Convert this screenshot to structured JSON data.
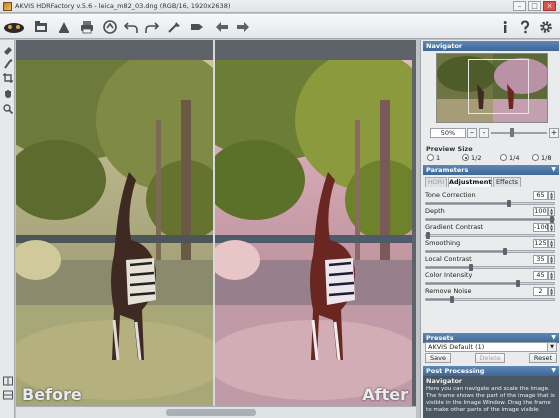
{
  "window": {
    "title": "AKVIS HDRFactory v.5.6 - leica_m82_03.dng (RGB/16, 1920x2638)",
    "controls": [
      "–",
      "□",
      "×"
    ]
  },
  "toolbar": {
    "icons": [
      "app-logo",
      "open-icon",
      "save-icon",
      "print-icon",
      "share-icon",
      "undo-icon",
      "redo-icon",
      "run-icon",
      "batch-icon",
      "back-icon",
      "forward-icon",
      "info-icon",
      "help-icon",
      "settings-icon"
    ]
  },
  "image": {
    "before_label": "Before",
    "after_label": "After"
  },
  "navigator": {
    "header": "Navigator",
    "zoom_value": "50%",
    "zoom_minus": "–",
    "zoom_plus": "+",
    "zoom_level_fraction": 0.38
  },
  "preview_size": {
    "header": "Preview Size",
    "options": [
      "1",
      "1/2",
      "1/4",
      "1/8"
    ],
    "selected": "1/2"
  },
  "parameters": {
    "header": "Parameters",
    "tabs": [
      "HDRI",
      "Adjustment",
      "Effects"
    ],
    "active_tab": "Adjustment",
    "items": [
      {
        "label": "Tone Correction",
        "value": "65",
        "fraction": 0.65
      },
      {
        "label": "Depth",
        "value": "100",
        "fraction": 1.0
      },
      {
        "label": "Gradient Contrast",
        "value": "-100",
        "fraction": 0.0
      },
      {
        "label": "Smoothing",
        "value": "125",
        "fraction": 0.62
      },
      {
        "label": "Local Contrast",
        "value": "35",
        "fraction": 0.35
      },
      {
        "label": "Color Intensity",
        "value": "45",
        "fraction": 0.72
      },
      {
        "label": "Remove Noise",
        "value": "2",
        "fraction": 0.2
      }
    ]
  },
  "presets": {
    "header": "Presets",
    "selected": "AKVIS Default (1)",
    "save": "Save",
    "delete": "Delete",
    "reset": "Reset"
  },
  "post_processing": {
    "header": "Post Processing"
  },
  "help": {
    "title": "Navigator",
    "text": "Here you can navigate and scale the image. The frame shows the part of the image that is visible in the Image Window. Drag the frame to make other parts of the image visible"
  },
  "colors": {
    "panel_header": "#4f77a6",
    "panel_bg": "#e9ebed",
    "help_bg": "#4a5661"
  }
}
